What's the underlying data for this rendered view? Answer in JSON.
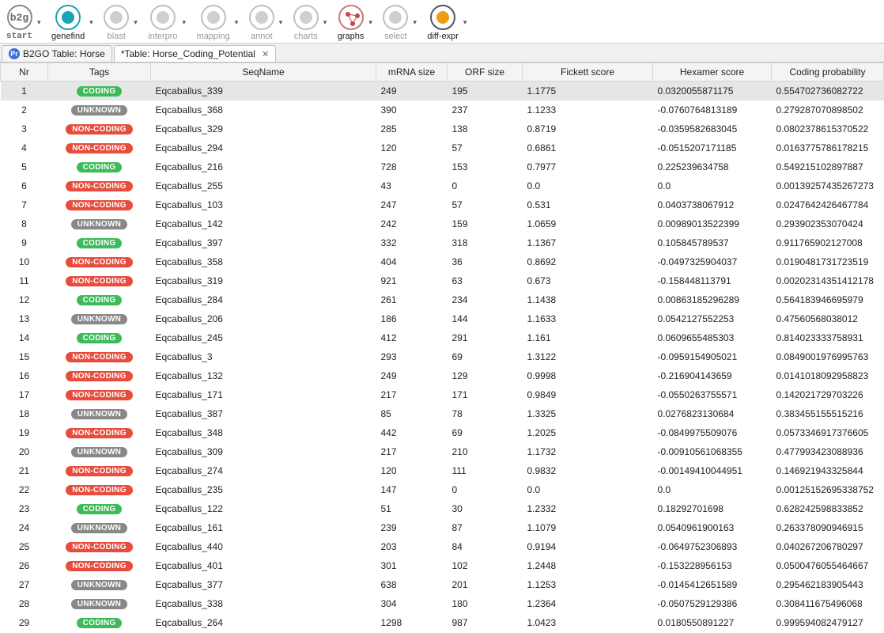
{
  "toolbar": [
    {
      "id": "start",
      "label": "start",
      "enabled": true,
      "icon": "b2g"
    },
    {
      "id": "genefind",
      "label": "genefind",
      "enabled": true,
      "icon": "genefind"
    },
    {
      "id": "blast",
      "label": "blast",
      "enabled": false,
      "icon": "generic"
    },
    {
      "id": "interpro",
      "label": "interpro",
      "enabled": false,
      "icon": "generic"
    },
    {
      "id": "mapping",
      "label": "mapping",
      "enabled": false,
      "icon": "generic"
    },
    {
      "id": "annot",
      "label": "annot",
      "enabled": false,
      "icon": "generic"
    },
    {
      "id": "charts",
      "label": "charts",
      "enabled": false,
      "icon": "generic"
    },
    {
      "id": "graphs",
      "label": "graphs",
      "enabled": true,
      "icon": "graphs"
    },
    {
      "id": "select",
      "label": "select",
      "enabled": false,
      "icon": "generic"
    },
    {
      "id": "diff-expr",
      "label": "diff-expr",
      "enabled": true,
      "icon": "diff"
    }
  ],
  "tabs": [
    {
      "title": "B2GO Table: Horse",
      "active": false,
      "hasIcon": true,
      "closeable": false
    },
    {
      "title": "*Table: Horse_Coding_Potential",
      "active": true,
      "hasIcon": false,
      "closeable": true
    }
  ],
  "columns": [
    "Nr",
    "Tags",
    "SeqName",
    "mRNA size",
    "ORF size",
    "Fickett score",
    "Hexamer score",
    "Coding probability"
  ],
  "tagStyles": {
    "CODING": "coding",
    "NON-CODING": "noncoding",
    "UNKNOWN": "unknown"
  },
  "rows": [
    {
      "nr": 1,
      "tag": "CODING",
      "seq": "Eqcaballus_339",
      "mrna": "249",
      "orf": "195",
      "fick": "1.1775",
      "hex": "0.0320055871175",
      "prob": "0.554702736082722",
      "sel": true
    },
    {
      "nr": 2,
      "tag": "UNKNOWN",
      "seq": "Eqcaballus_368",
      "mrna": "390",
      "orf": "237",
      "fick": "1.1233",
      "hex": "-0.0760764813189",
      "prob": "0.279287070898502"
    },
    {
      "nr": 3,
      "tag": "NON-CODING",
      "seq": "Eqcaballus_329",
      "mrna": "285",
      "orf": "138",
      "fick": "0.8719",
      "hex": "-0.0359582683045",
      "prob": "0.0802378615370522"
    },
    {
      "nr": 4,
      "tag": "NON-CODING",
      "seq": "Eqcaballus_294",
      "mrna": "120",
      "orf": "57",
      "fick": "0.6861",
      "hex": "-0.0515207171185",
      "prob": "0.0163775786178215"
    },
    {
      "nr": 5,
      "tag": "CODING",
      "seq": "Eqcaballus_216",
      "mrna": "728",
      "orf": "153",
      "fick": "0.7977",
      "hex": "0.225239634758",
      "prob": "0.549215102897887"
    },
    {
      "nr": 6,
      "tag": "NON-CODING",
      "seq": "Eqcaballus_255",
      "mrna": "43",
      "orf": "0",
      "fick": "0.0",
      "hex": "0.0",
      "prob": "0.00139257435267273"
    },
    {
      "nr": 7,
      "tag": "NON-CODING",
      "seq": "Eqcaballus_103",
      "mrna": "247",
      "orf": "57",
      "fick": "0.531",
      "hex": "0.0403738067912",
      "prob": "0.0247642426467784"
    },
    {
      "nr": 8,
      "tag": "UNKNOWN",
      "seq": "Eqcaballus_142",
      "mrna": "242",
      "orf": "159",
      "fick": "1.0659",
      "hex": "0.00989013522399",
      "prob": "0.293902353070424"
    },
    {
      "nr": 9,
      "tag": "CODING",
      "seq": "Eqcaballus_397",
      "mrna": "332",
      "orf": "318",
      "fick": "1.1367",
      "hex": "0.105845789537",
      "prob": "0.911765902127008"
    },
    {
      "nr": 10,
      "tag": "NON-CODING",
      "seq": "Eqcaballus_358",
      "mrna": "404",
      "orf": "36",
      "fick": "0.8692",
      "hex": "-0.0497325904037",
      "prob": "0.0190481731723519"
    },
    {
      "nr": 11,
      "tag": "NON-CODING",
      "seq": "Eqcaballus_319",
      "mrna": "921",
      "orf": "63",
      "fick": "0.673",
      "hex": "-0.158448113791",
      "prob": "0.00202314351412178"
    },
    {
      "nr": 12,
      "tag": "CODING",
      "seq": "Eqcaballus_284",
      "mrna": "261",
      "orf": "234",
      "fick": "1.1438",
      "hex": "0.00863185296289",
      "prob": "0.564183946695979"
    },
    {
      "nr": 13,
      "tag": "UNKNOWN",
      "seq": "Eqcaballus_206",
      "mrna": "186",
      "orf": "144",
      "fick": "1.1633",
      "hex": "0.0542127552253",
      "prob": "0.47560568038012"
    },
    {
      "nr": 14,
      "tag": "CODING",
      "seq": "Eqcaballus_245",
      "mrna": "412",
      "orf": "291",
      "fick": "1.161",
      "hex": "0.0609655485303",
      "prob": "0.814023333758931"
    },
    {
      "nr": 15,
      "tag": "NON-CODING",
      "seq": "Eqcaballus_3",
      "mrna": "293",
      "orf": "69",
      "fick": "1.3122",
      "hex": "-0.0959154905021",
      "prob": "0.0849001976995763"
    },
    {
      "nr": 16,
      "tag": "NON-CODING",
      "seq": "Eqcaballus_132",
      "mrna": "249",
      "orf": "129",
      "fick": "0.9998",
      "hex": "-0.216904143659",
      "prob": "0.0141018092958823"
    },
    {
      "nr": 17,
      "tag": "NON-CODING",
      "seq": "Eqcaballus_171",
      "mrna": "217",
      "orf": "171",
      "fick": "0.9849",
      "hex": "-0.0550263755571",
      "prob": "0.142021729703226"
    },
    {
      "nr": 18,
      "tag": "UNKNOWN",
      "seq": "Eqcaballus_387",
      "mrna": "85",
      "orf": "78",
      "fick": "1.3325",
      "hex": "0.0276823130684",
      "prob": "0.383455155515216"
    },
    {
      "nr": 19,
      "tag": "NON-CODING",
      "seq": "Eqcaballus_348",
      "mrna": "442",
      "orf": "69",
      "fick": "1.2025",
      "hex": "-0.0849975509076",
      "prob": "0.0573346917376605"
    },
    {
      "nr": 20,
      "tag": "UNKNOWN",
      "seq": "Eqcaballus_309",
      "mrna": "217",
      "orf": "210",
      "fick": "1.1732",
      "hex": "-0.00910561068355",
      "prob": "0.477993423088936"
    },
    {
      "nr": 21,
      "tag": "NON-CODING",
      "seq": "Eqcaballus_274",
      "mrna": "120",
      "orf": "111",
      "fick": "0.9832",
      "hex": "-0.00149410044951",
      "prob": "0.146921943325844"
    },
    {
      "nr": 22,
      "tag": "NON-CODING",
      "seq": "Eqcaballus_235",
      "mrna": "147",
      "orf": "0",
      "fick": "0.0",
      "hex": "0.0",
      "prob": "0.00125152695338752"
    },
    {
      "nr": 23,
      "tag": "CODING",
      "seq": "Eqcaballus_122",
      "mrna": "51",
      "orf": "30",
      "fick": "1.2332",
      "hex": "0.18292701698",
      "prob": "0.628242598833852"
    },
    {
      "nr": 24,
      "tag": "UNKNOWN",
      "seq": "Eqcaballus_161",
      "mrna": "239",
      "orf": "87",
      "fick": "1.1079",
      "hex": "0.0540961900163",
      "prob": "0.263378090946915"
    },
    {
      "nr": 25,
      "tag": "NON-CODING",
      "seq": "Eqcaballus_440",
      "mrna": "203",
      "orf": "84",
      "fick": "0.9194",
      "hex": "-0.0649752306893",
      "prob": "0.040267206780297"
    },
    {
      "nr": 26,
      "tag": "NON-CODING",
      "seq": "Eqcaballus_401",
      "mrna": "301",
      "orf": "102",
      "fick": "1.2448",
      "hex": "-0.153228956153",
      "prob": "0.0500476055464667"
    },
    {
      "nr": 27,
      "tag": "UNKNOWN",
      "seq": "Eqcaballus_377",
      "mrna": "638",
      "orf": "201",
      "fick": "1.1253",
      "hex": "-0.0145412651589",
      "prob": "0.295462183905443"
    },
    {
      "nr": 28,
      "tag": "UNKNOWN",
      "seq": "Eqcaballus_338",
      "mrna": "304",
      "orf": "180",
      "fick": "1.2364",
      "hex": "-0.0507529129386",
      "prob": "0.308411675496068"
    },
    {
      "nr": 29,
      "tag": "CODING",
      "seq": "Eqcaballus_264",
      "mrna": "1298",
      "orf": "987",
      "fick": "1.0423",
      "hex": "0.0180550891227",
      "prob": "0.999594082479127"
    }
  ]
}
